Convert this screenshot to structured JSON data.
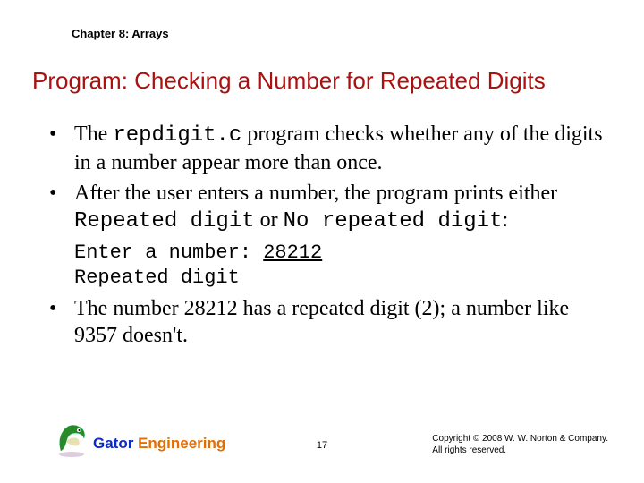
{
  "chapter": "Chapter 8: Arrays",
  "title": "Program: Checking a Number for Repeated Digits",
  "bullets": {
    "b1_pre": "The ",
    "b1_code": "repdigit.c",
    "b1_post": " program checks whether any of the digits in a number appear more than once.",
    "b2_pre": "After the user enters a number, the program prints either ",
    "b2_code1": "Repeated digit",
    "b2_mid": " or ",
    "b2_code2": "No repeated digit",
    "b2_post": ":",
    "b3": "The number 28212 has a repeated digit (2); a number like 9357 doesn't."
  },
  "example": {
    "line1_prompt": "Enter a number: ",
    "line1_input": "28212",
    "line2": "Repeated digit"
  },
  "footer": {
    "brand_gator": "Gator ",
    "brand_eng": "Engineering",
    "page": "17",
    "copy1": "Copyright © 2008 W. W. Norton & Company.",
    "copy2": "All rights reserved."
  }
}
